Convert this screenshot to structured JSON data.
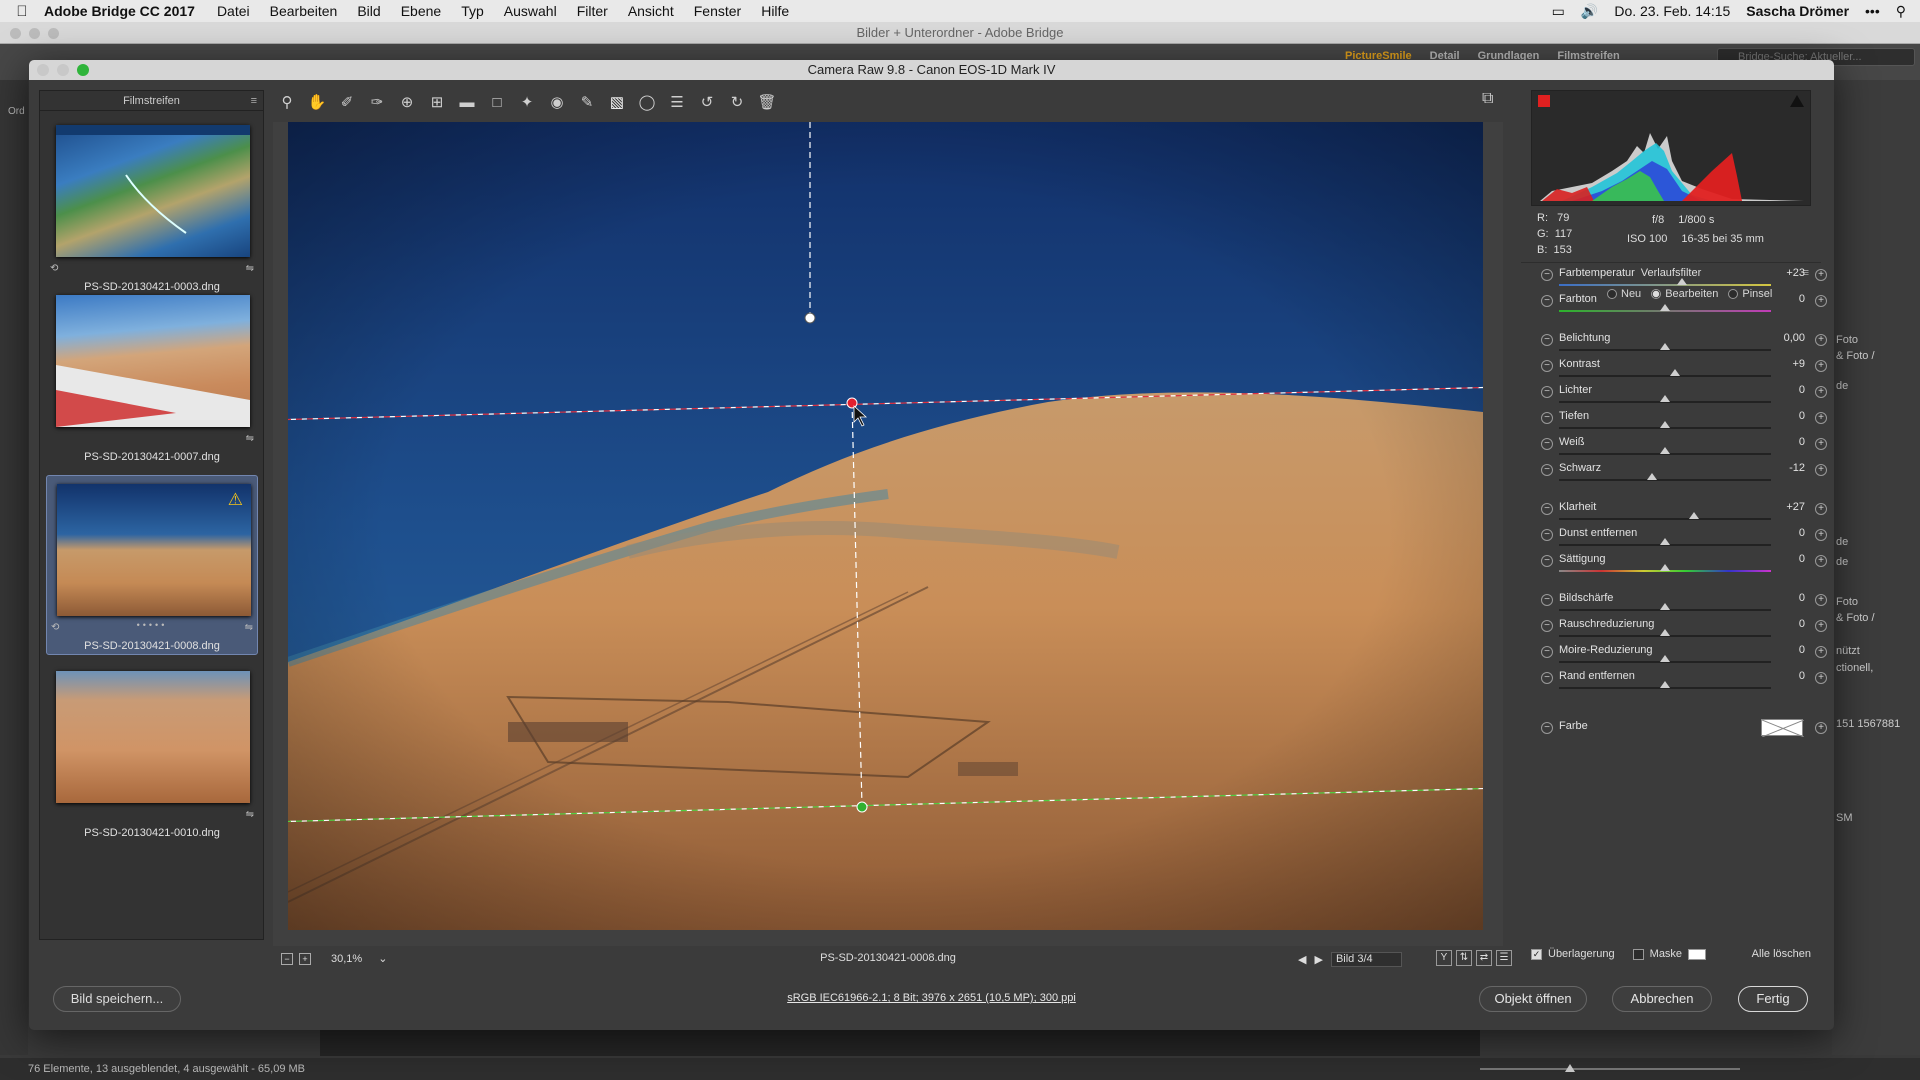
{
  "menubar": {
    "app": "Adobe Bridge CC 2017",
    "items": [
      "Datei",
      "Bearbeiten",
      "Bild",
      "Ebene",
      "Typ",
      "Auswahl",
      "Filter",
      "Ansicht",
      "Fenster",
      "Hilfe"
    ],
    "datetime": "Do. 23. Feb.  14:15",
    "user": "Sascha Drömer"
  },
  "bridge": {
    "title": "Bilder + Unterordner - Adobe Bridge",
    "tabs": [
      "PictureSmile",
      "Detail",
      "Grundlagen",
      "Filmstreifen"
    ],
    "search_placeholder": "Bridge-Suche: Aktueller...",
    "left_label": "Ord",
    "right_texts": [
      "Foto",
      "& Foto /",
      "de",
      "de",
      "de",
      "Foto",
      "& Foto /",
      "nützt",
      "ctionell,",
      "151 1567881",
      "SM"
    ],
    "status": "76 Elemente, 13 ausgeblendet, 4 ausgewählt - 65,09 MB"
  },
  "dialog": {
    "title": "Camera Raw 9.8  -  Canon EOS-1D Mark IV",
    "filmstrip": {
      "header": "Filmstreifen",
      "items": [
        {
          "name": "PS-SD-20130421-0003.dng",
          "selected": false
        },
        {
          "name": "PS-SD-20130421-0007.dng",
          "selected": false
        },
        {
          "name": "PS-SD-20130421-0008.dng",
          "selected": true,
          "warning": true
        },
        {
          "name": "PS-SD-20130421-0010.dng",
          "selected": false
        }
      ]
    },
    "tools": [
      "zoom-icon",
      "hand-icon",
      "white-balance-icon",
      "color-sampler-icon",
      "targeted-adjust-icon",
      "crop-icon",
      "straighten-icon",
      "transform-icon",
      "spot-removal-icon",
      "red-eye-icon",
      "adjustment-brush-icon",
      "graduated-filter-icon",
      "radial-filter-icon",
      "preferences-icon",
      "rotate-left-icon",
      "rotate-right-icon",
      "trash-icon"
    ],
    "preview": {
      "zoom": "30,1%",
      "filename": "PS-SD-20130421-0008.dng",
      "image_nav": "Bild 3/4"
    },
    "histogram": {
      "r": "79",
      "g": "117",
      "b": "153",
      "aperture": "f/8",
      "shutter": "1/800 s",
      "iso": "ISO 100",
      "lens": "16-35 bei 35 mm"
    },
    "panel": {
      "title": "Verlaufsfilter",
      "modes": [
        {
          "label": "Neu",
          "selected": false
        },
        {
          "label": "Bearbeiten",
          "selected": true
        },
        {
          "label": "Pinsel",
          "selected": false
        }
      ],
      "sliders": [
        {
          "label": "Farbtemperatur",
          "value": "+23",
          "pos": 0.58
        },
        {
          "label": "Farbton",
          "value": "0",
          "pos": 0.5
        },
        {
          "label": "Belichtung",
          "value": "0,00",
          "pos": 0.5
        },
        {
          "label": "Kontrast",
          "value": "+9",
          "pos": 0.545
        },
        {
          "label": "Lichter",
          "value": "0",
          "pos": 0.5
        },
        {
          "label": "Tiefen",
          "value": "0",
          "pos": 0.5
        },
        {
          "label": "Weiß",
          "value": "0",
          "pos": 0.5
        },
        {
          "label": "Schwarz",
          "value": "-12",
          "pos": 0.44
        },
        {
          "label": "Klarheit",
          "value": "+27",
          "pos": 0.635
        },
        {
          "label": "Dunst entfernen",
          "value": "0",
          "pos": 0.5
        },
        {
          "label": "Sättigung",
          "value": "0",
          "pos": 0.5
        },
        {
          "label": "Bildschärfe",
          "value": "0",
          "pos": 0.5
        },
        {
          "label": "Rauschreduzierung",
          "value": "0",
          "pos": 0.5
        },
        {
          "label": "Moire-Reduzierung",
          "value": "0",
          "pos": 0.5
        },
        {
          "label": "Rand entfernen",
          "value": "0",
          "pos": 0.5
        }
      ],
      "color_label": "Farbe",
      "overlay_label": "Überlagerung",
      "overlay_checked": true,
      "mask_label": "Maske",
      "mask_checked": false,
      "clear_all": "Alle löschen"
    },
    "workflow": "sRGB IEC61966-2.1; 8 Bit; 3976 x 2651 (10,5 MP); 300 ppi",
    "buttons": {
      "save": "Bild speichern...",
      "open": "Objekt öffnen",
      "cancel": "Abbrechen",
      "done": "Fertig"
    }
  }
}
